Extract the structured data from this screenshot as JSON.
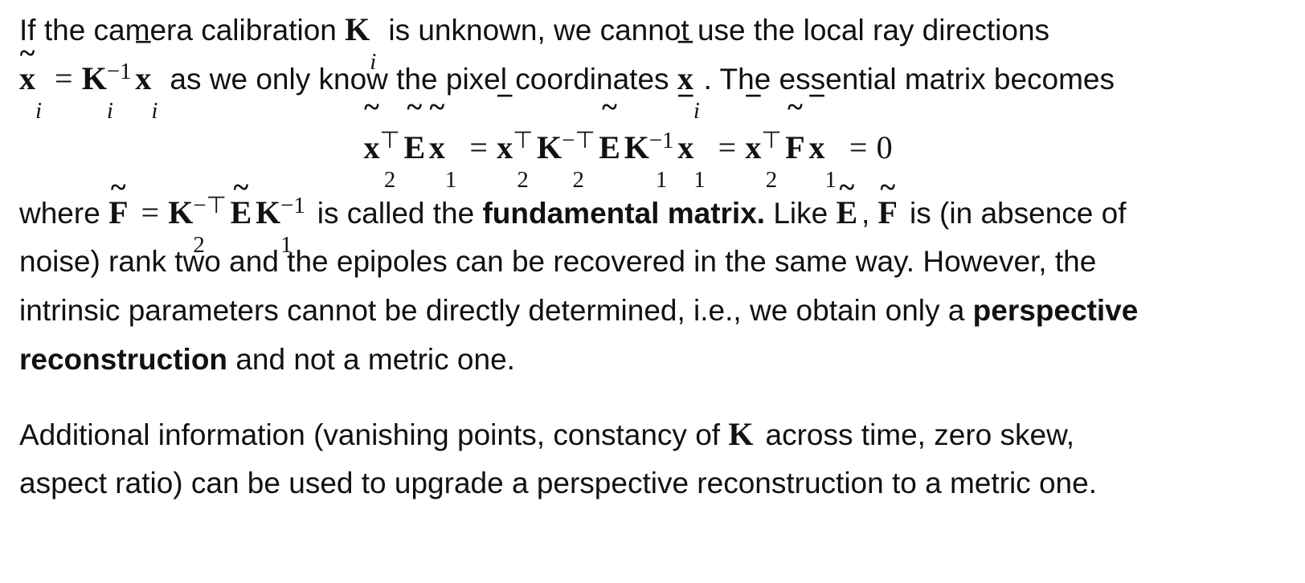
{
  "paragraphs": [
    {
      "cls": "p1",
      "lines": [
        [
          {
            "t": "If the camera calibration "
          },
          {
            "m": [
              {
                "v": "K",
                "bold": true,
                "sub": "i",
                "subit": true
              }
            ]
          },
          {
            "t": " is unknown, we cannot use the local ray directions"
          }
        ],
        [
          {
            "m": [
              {
                "v": "x",
                "bold": true,
                "acc": "~",
                "sub": "i",
                "subit": true
              },
              {
                "op": "="
              },
              {
                "v": "K",
                "bold": true,
                "sub": "i",
                "subit": true,
                "sup": "−1"
              },
              {
                "v": "x",
                "bold": true,
                "acc": "¯",
                "sub": "i",
                "subit": true
              }
            ]
          },
          {
            "t": " as we only know the pixel coordinates "
          },
          {
            "m": [
              {
                "v": "x",
                "bold": true,
                "acc": "¯",
                "sub": "i",
                "subit": true
              }
            ]
          },
          {
            "t": ". The essential matrix becomes"
          }
        ]
      ]
    },
    {
      "cls": "p2 eq",
      "lines": [
        [
          {
            "m": [
              {
                "v": "x",
                "bold": true,
                "acc": "~",
                "sub": "2",
                "sup": "⊤"
              },
              {
                "v": "E",
                "bold": true,
                "acc": "~"
              },
              {
                "v": "x",
                "bold": true,
                "acc": "~",
                "sub": "1"
              },
              {
                "op": "="
              },
              {
                "v": "x",
                "bold": true,
                "acc": "¯",
                "sub": "2",
                "sup": "⊤"
              },
              {
                "v": "K",
                "bold": true,
                "sub": "2",
                "sup": "−⊤"
              },
              {
                "v": "E",
                "bold": true,
                "acc": "~"
              },
              {
                "v": "K",
                "bold": true,
                "sub": "1",
                "sup": "−1"
              },
              {
                "v": "x",
                "bold": true,
                "acc": "¯",
                "sub": "1"
              },
              {
                "op": "="
              },
              {
                "v": "x",
                "bold": true,
                "acc": "¯",
                "sub": "2",
                "sup": "⊤"
              },
              {
                "v": "F",
                "bold": true,
                "acc": "~"
              },
              {
                "v": "x",
                "bold": true,
                "acc": "¯",
                "sub": "1"
              },
              {
                "op": "="
              },
              {
                "v": "0"
              }
            ]
          }
        ]
      ]
    },
    {
      "cls": "p3",
      "lines": [
        [
          {
            "t": "where "
          },
          {
            "m": [
              {
                "v": "F",
                "bold": true,
                "acc": "~"
              },
              {
                "op": "="
              },
              {
                "v": "K",
                "bold": true,
                "sub": "2",
                "sup": "−⊤"
              },
              {
                "v": "E",
                "bold": true,
                "acc": "~"
              },
              {
                "v": "K",
                "bold": true,
                "sub": "1",
                "sup": "−1"
              }
            ]
          },
          {
            "t": " is called the "
          },
          {
            "b": "fundamental matrix."
          },
          {
            "t": " Like "
          },
          {
            "m": [
              {
                "v": "E",
                "bold": true,
                "acc": "~"
              }
            ]
          },
          {
            "t": ", "
          },
          {
            "m": [
              {
                "v": "F",
                "bold": true,
                "acc": "~"
              }
            ]
          },
          {
            "t": " is (in absence of"
          }
        ],
        [
          {
            "t": "noise) rank two and the epipoles can be recovered in the same way. However, the"
          }
        ],
        [
          {
            "t": "intrinsic parameters cannot be directly determined, i.e., we obtain only a "
          },
          {
            "b": "perspective"
          }
        ],
        [
          {
            "b": "reconstruction"
          },
          {
            "t": " and not a metric one."
          }
        ]
      ]
    },
    {
      "cls": "p4",
      "lines": [
        [
          {
            "t": "Additional information (vanishing points, constancy of "
          },
          {
            "m": [
              {
                "v": "K",
                "bold": true
              }
            ]
          },
          {
            "t": " across time, zero skew,"
          }
        ],
        [
          {
            "t": "aspect ratio) can be used to upgrade a perspective reconstruction to a metric one."
          }
        ]
      ]
    }
  ]
}
